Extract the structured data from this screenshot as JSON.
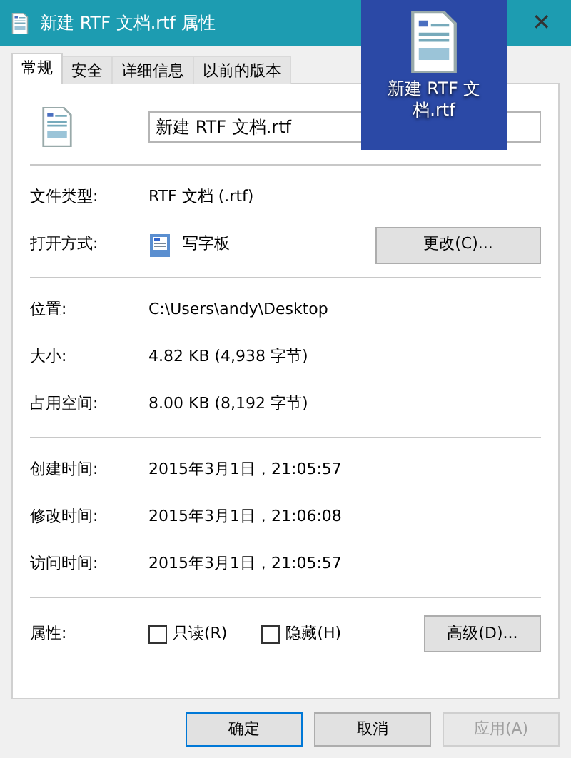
{
  "window": {
    "title": "新建 RTF 文档.rtf 属性",
    "close": "✕"
  },
  "tabs": [
    {
      "label": "常规",
      "selected": true
    },
    {
      "label": "安全",
      "selected": false
    },
    {
      "label": "详细信息",
      "selected": false
    },
    {
      "label": "以前的版本",
      "selected": false
    }
  ],
  "file_name": {
    "value": "新建 RTF 文档.rtf"
  },
  "sections": [
    [
      {
        "label": "文件类型:",
        "value": "RTF 文档 (.rtf)",
        "kind": "text"
      },
      {
        "label": "打开方式:",
        "value": "写字板",
        "kind": "app",
        "button": "更改(C)..."
      }
    ],
    [
      {
        "label": "位置:",
        "value": "C:\\Users\\andy\\Desktop",
        "kind": "text"
      },
      {
        "label": "大小:",
        "value": "4.82 KB (4,938 字节)",
        "kind": "text"
      },
      {
        "label": "占用空间:",
        "value": "8.00 KB (8,192 字节)",
        "kind": "text"
      }
    ],
    [
      {
        "label": "创建时间:",
        "value": "2015年3月1日，21:05:57",
        "kind": "text"
      },
      {
        "label": "修改时间:",
        "value": "2015年3月1日，21:06:08",
        "kind": "text"
      },
      {
        "label": "访问时间:",
        "value": "2015年3月1日，21:05:57",
        "kind": "text"
      }
    ]
  ],
  "attributes": {
    "label": "属性:",
    "options": [
      {
        "label": "只读(R)",
        "checked": false
      },
      {
        "label": "隐藏(H)",
        "checked": false
      }
    ],
    "button": "高级(D)..."
  },
  "buttons": [
    {
      "label": "确定",
      "disabled": false,
      "default": true
    },
    {
      "label": "取消",
      "disabled": false,
      "default": false
    },
    {
      "label": "应用(A)",
      "disabled": true,
      "default": false
    }
  ],
  "desktop_icon": {
    "label": "新建 RTF 文档.rtf"
  }
}
